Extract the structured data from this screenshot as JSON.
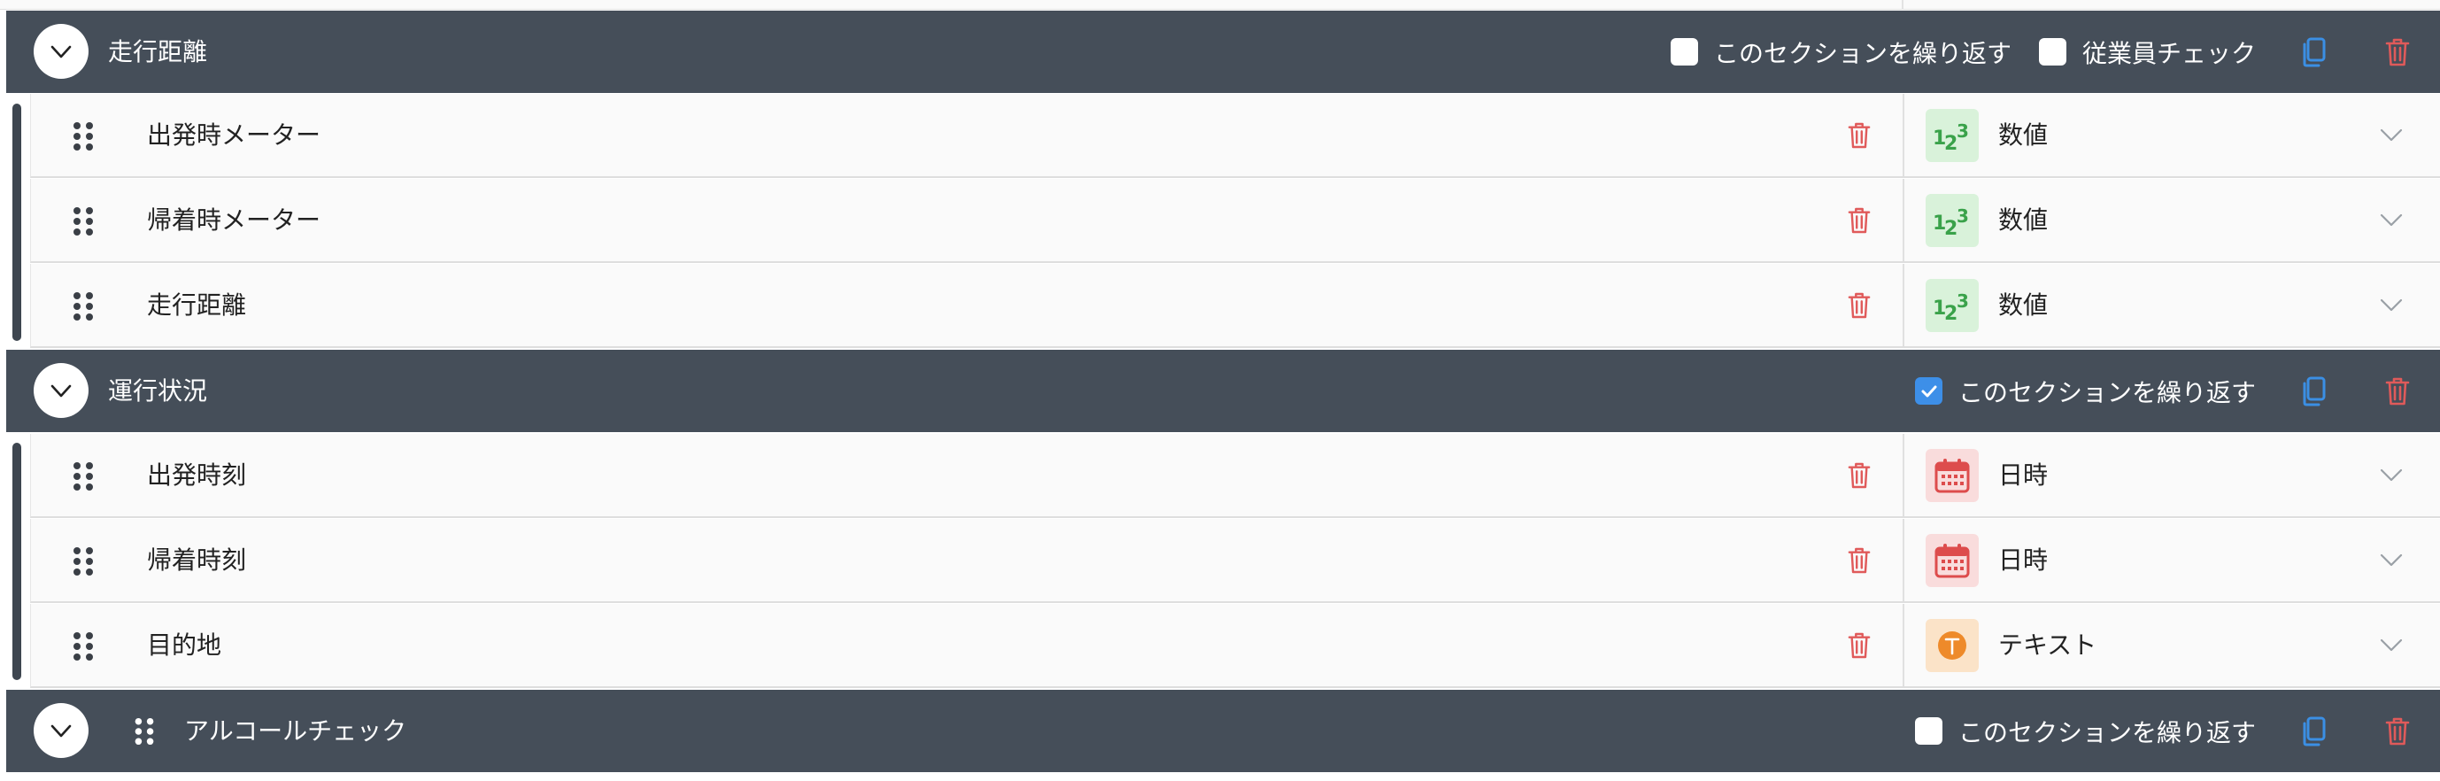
{
  "sections": [
    {
      "title": "走行距離",
      "repeat_label": "このセクションを繰り返す",
      "repeat_checked": false,
      "employee_check_label": "従業員チェック",
      "employee_check_checked": false,
      "fields": [
        {
          "label": "出発時メーター",
          "type_label": "数値",
          "type_icon": "number-123-icon"
        },
        {
          "label": "帰着時メーター",
          "type_label": "数値",
          "type_icon": "number-123-icon"
        },
        {
          "label": "走行距離",
          "type_label": "数値",
          "type_icon": "number-123-icon"
        }
      ]
    },
    {
      "title": "運行状況",
      "repeat_label": "このセクションを繰り返す",
      "repeat_checked": true,
      "fields": [
        {
          "label": "出発時刻",
          "type_label": "日時",
          "type_icon": "calendar-icon"
        },
        {
          "label": "帰着時刻",
          "type_label": "日時",
          "type_icon": "calendar-icon"
        },
        {
          "label": "目的地",
          "type_label": "テキスト",
          "type_icon": "text-t-icon"
        }
      ]
    },
    {
      "title": "アルコールチェック",
      "repeat_label": "このセクションを繰り返す",
      "repeat_checked": false,
      "fields": []
    }
  ],
  "colors": {
    "header_bg": "#454e59",
    "checkbox_checked": "#3d8fe8",
    "copy_icon": "#3b8fe4",
    "delete_icon": "#e05a5a",
    "number_badge": "#d9f2da",
    "date_badge": "#f9dcdc",
    "text_badge": "#fbe3c8"
  }
}
